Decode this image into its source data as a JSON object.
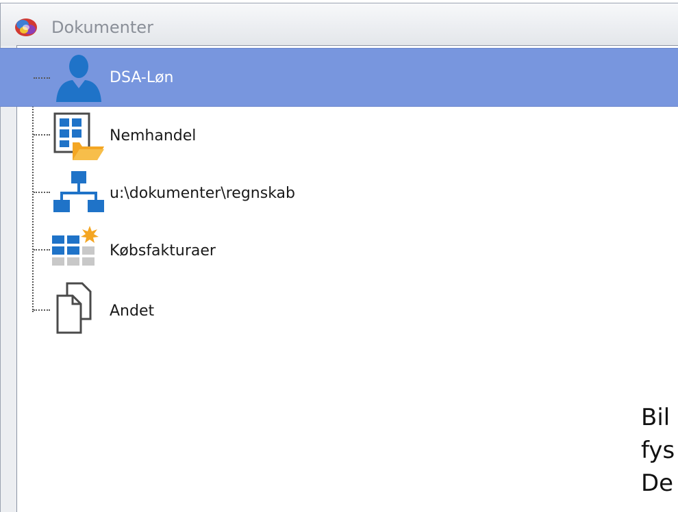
{
  "window": {
    "title": "Dokumenter",
    "app_icon": "app-logo-icon"
  },
  "tree": {
    "items": [
      {
        "label": "DSA-Løn",
        "icon": "person-icon",
        "selected": true
      },
      {
        "label": "Nemhandel",
        "icon": "folder-grid-icon",
        "selected": false
      },
      {
        "label": "u:\\dokumenter\\regnskab",
        "icon": "network-icon",
        "selected": false
      },
      {
        "label": "Købsfakturaer",
        "icon": "grid-star-icon",
        "selected": false
      },
      {
        "label": "Andet",
        "icon": "documents-icon",
        "selected": false
      }
    ]
  },
  "side_text": {
    "line1": "Bil",
    "line2": "fys",
    "line3": "De"
  },
  "colors": {
    "selection": "#7896de",
    "icon_blue": "#1f73c8",
    "icon_orange": "#f4a623",
    "icon_gray": "#4a4a4a"
  }
}
